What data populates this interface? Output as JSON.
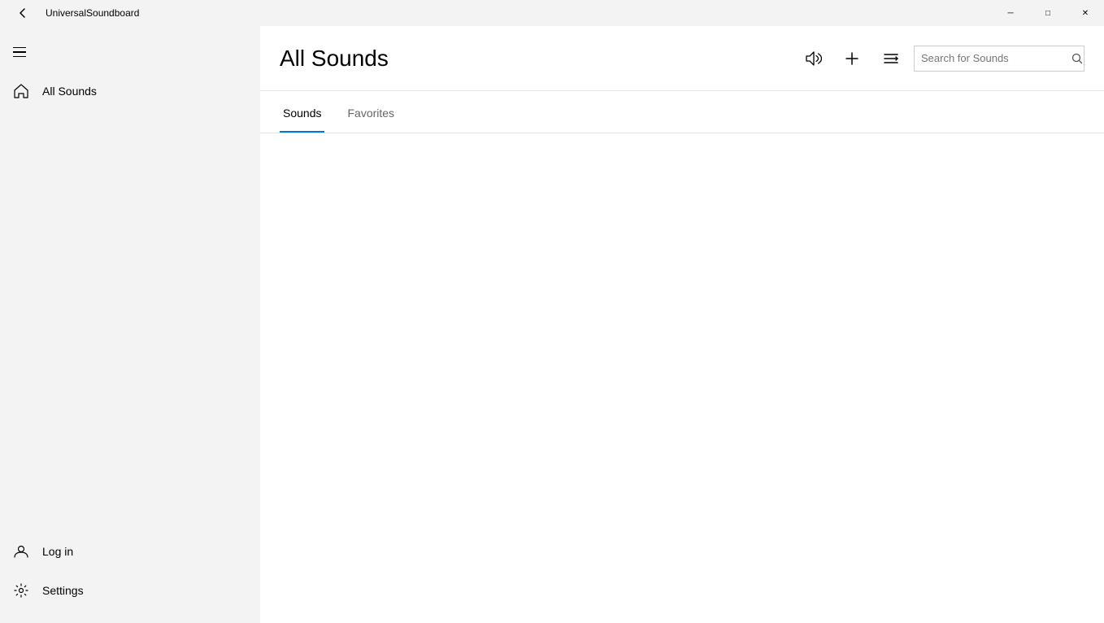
{
  "titlebar": {
    "title": "UniversalSoundboard",
    "minimize_label": "─",
    "maximize_label": "□",
    "close_label": "✕"
  },
  "sidebar": {
    "hamburger_label": "Menu",
    "nav_items": [
      {
        "id": "all-sounds",
        "label": "All Sounds",
        "icon": "home"
      }
    ],
    "bottom_items": [
      {
        "id": "log-in",
        "label": "Log in",
        "icon": "person"
      },
      {
        "id": "settings",
        "label": "Settings",
        "icon": "gear"
      }
    ]
  },
  "header": {
    "title": "All Sounds",
    "search_placeholder": "Search for Sounds"
  },
  "tabs": [
    {
      "id": "sounds",
      "label": "Sounds",
      "active": true
    },
    {
      "id": "favorites",
      "label": "Favorites",
      "active": false
    }
  ]
}
